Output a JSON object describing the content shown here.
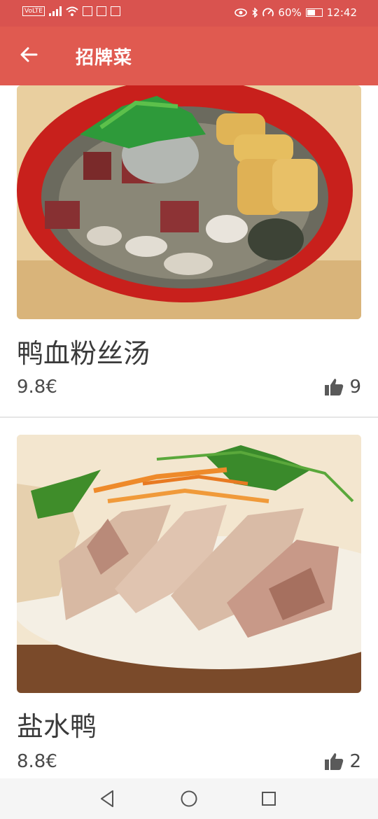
{
  "status_bar": {
    "volte": "VoLTE",
    "battery_percent": 60,
    "battery_text": "60%",
    "time": "12:42"
  },
  "app_bar": {
    "title": "招牌菜",
    "back_icon": "arrow-left-icon"
  },
  "dishes": [
    {
      "name": "鸭血粉丝汤",
      "price": "9.8€",
      "likes": "9",
      "image": "duck-blood-vermicelli-soup-photo"
    },
    {
      "name": "盐水鸭",
      "price": "8.8€",
      "likes": "2",
      "image": "salted-duck-photo"
    }
  ],
  "nav_bar": {
    "back": "triangle-back-icon",
    "home": "circle-home-icon",
    "recents": "square-recents-icon"
  },
  "colors": {
    "status_bar": "#d9534f",
    "app_bar": "#e05a50",
    "bowl_red": "#c8201c",
    "text": "#3a3a3a"
  }
}
